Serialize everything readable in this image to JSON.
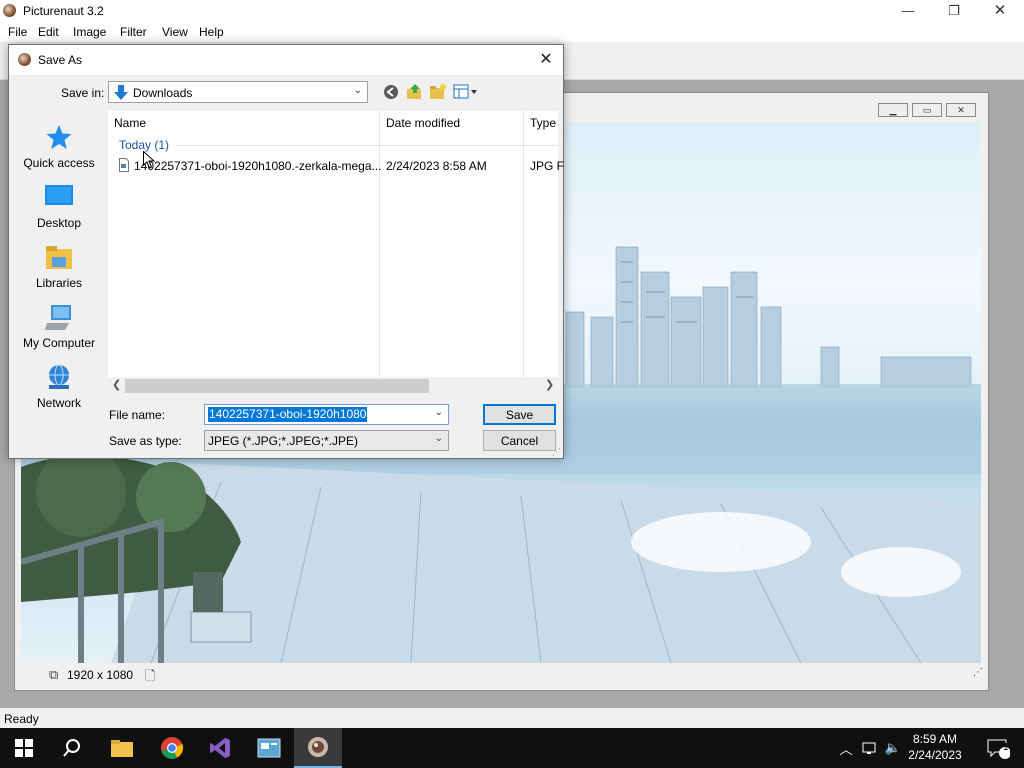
{
  "app": {
    "title": "Picturenaut 3.2",
    "menu": [
      "File",
      "Edit",
      "Image",
      "Filter",
      "View",
      "Help"
    ],
    "status": "Ready",
    "image_dimensions": "1920 x 1080"
  },
  "dialog": {
    "title": "Save As",
    "save_in_label": "Save in:",
    "save_in_value": "Downloads",
    "places": [
      "Quick access",
      "Desktop",
      "Libraries",
      "My Computer",
      "Network"
    ],
    "columns": [
      "Name",
      "Date modified",
      "Type"
    ],
    "group_header": "Today (1)",
    "files": [
      {
        "name": "1402257371-oboi-1920h1080.-zerkala-mega...",
        "date": "2/24/2023 8:58 AM",
        "type": "JPG F"
      }
    ],
    "file_name_label": "File name:",
    "file_name_value": "1402257371-oboi-1920h1080",
    "save_type_label": "Save as type:",
    "save_type_value": "JPEG (*.JPG;*.JPEG;*.JPE)",
    "save_button": "Save",
    "cancel_button": "Cancel"
  },
  "taskbar": {
    "time": "8:59 AM",
    "date": "2/24/2023",
    "notification_count": "1"
  },
  "colors": {
    "selection": "#0078d7",
    "group_header": "#1f4e9e",
    "taskbar": "#101010"
  }
}
